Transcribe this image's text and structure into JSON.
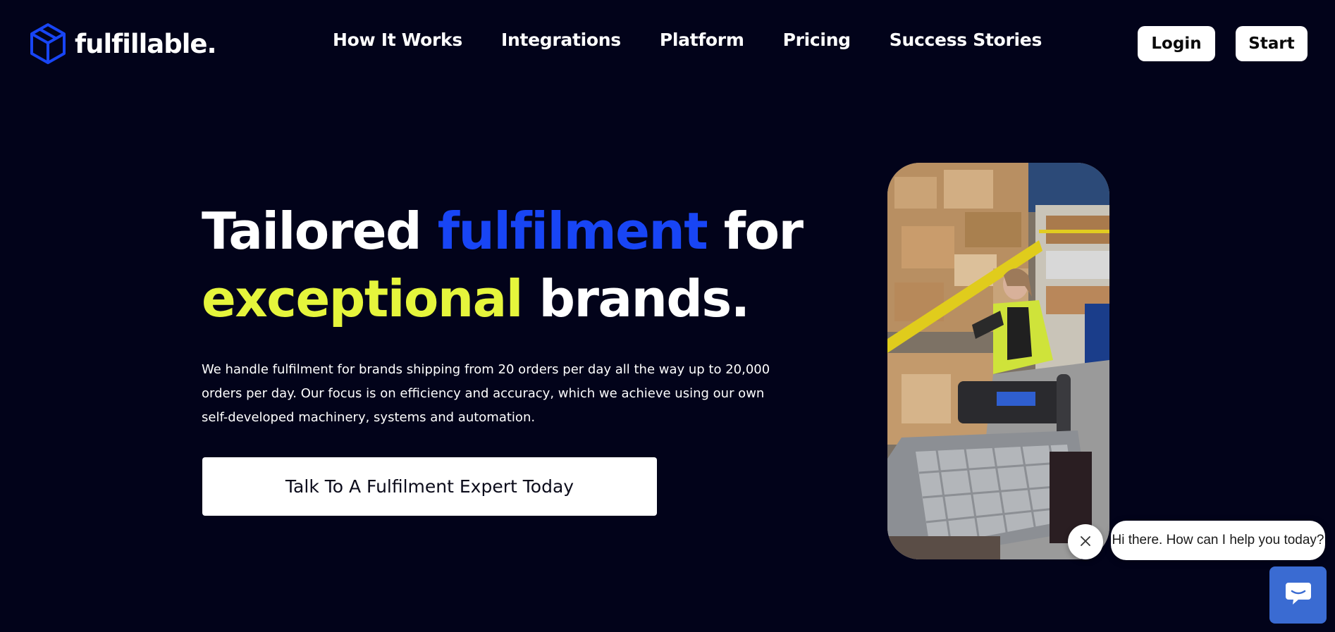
{
  "brand": {
    "name": "fulfillable.",
    "accent_blue": "#1845f5",
    "accent_yellow": "#e5f53c",
    "background": "#02031a"
  },
  "nav": {
    "items": [
      {
        "label": "How It Works"
      },
      {
        "label": "Integrations"
      },
      {
        "label": "Platform"
      },
      {
        "label": "Pricing"
      },
      {
        "label": "Success Stories"
      }
    ],
    "login_label": "Login",
    "start_label": "Start"
  },
  "hero": {
    "title_part1": "Tailored ",
    "title_highlight_blue": "fulfilment",
    "title_part2": " for",
    "title_highlight_yellow": "exceptional",
    "title_part3": " brands.",
    "description": "We handle fulfilment for brands shipping from 20 orders per day all the way up to 20,000 orders per day. Our focus is on efficiency and accuracy, which we achieve using our own self-developed machinery, systems and automation.",
    "cta_label": "Talk To A Fulfilment Expert Today"
  },
  "chat": {
    "greeting": "Hi there. How can I help you today?",
    "close_icon": "close-icon",
    "launcher_icon": "chat-icon",
    "launcher_color": "#3a6bd2"
  }
}
